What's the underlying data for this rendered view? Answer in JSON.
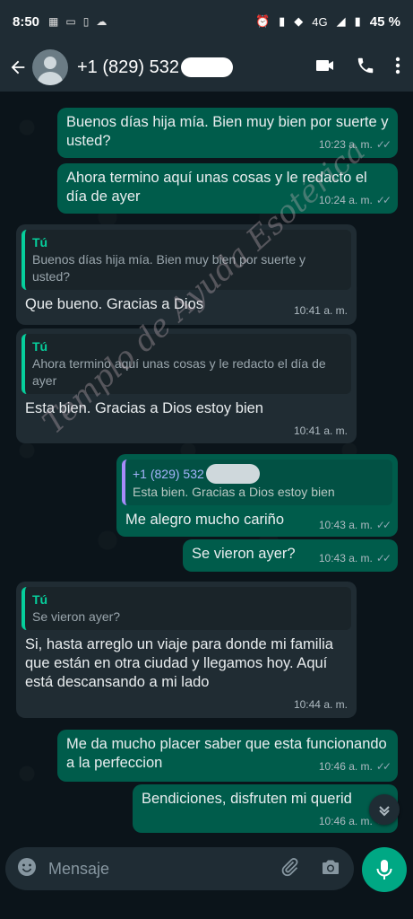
{
  "status_bar": {
    "time": "8:50",
    "network": "4G",
    "battery": "45 %"
  },
  "header": {
    "contact_name": "+1 (829) 532"
  },
  "messages": [
    {
      "dir": "out",
      "text": "Buenos días hija mía. Bien muy bien por suerte y usted?",
      "time": "10:23 a. m."
    },
    {
      "dir": "out",
      "text": "Ahora termino aquí unas cosas y le redacto el día de ayer",
      "time": "10:24 a. m."
    },
    {
      "dir": "in",
      "quote_author": "Tú",
      "quote_text": "Buenos días hija mía. Bien muy bien por suerte y usted?",
      "text": "Que bueno. Gracias a Dios",
      "time": "10:41 a. m."
    },
    {
      "dir": "in",
      "quote_author": "Tú",
      "quote_text": "Ahora termino aquí unas cosas y le redacto el día de ayer",
      "text": "Esta bien. Gracias a Dios estoy bien",
      "time": "10:41 a. m."
    },
    {
      "dir": "out",
      "quote_author": "+1 (829) 532",
      "quote_text": "Esta bien. Gracias a Dios estoy bien",
      "text": "Me alegro mucho cariño",
      "time": "10:43 a. m."
    },
    {
      "dir": "out",
      "text": "Se vieron ayer?",
      "time": "10:43 a. m."
    },
    {
      "dir": "in",
      "quote_author": "Tú",
      "quote_text": "Se vieron ayer?",
      "text": "Si, hasta arreglo un viaje para donde mi familia que están en otra ciudad y llegamos hoy. Aquí está descansando  a mi lado",
      "time": "10:44 a. m."
    },
    {
      "dir": "out",
      "text": "Me da mucho placer saber que esta funcionando a la perfeccion",
      "time": "10:46 a. m."
    },
    {
      "dir": "out",
      "text": "Bendiciones, disfruten mi querid",
      "time": "10:46 a. m."
    }
  ],
  "composer": {
    "placeholder": "Mensaje"
  },
  "watermark": "Templo de Ayuda Esotérica",
  "colors": {
    "outgoing_bubble": "#005c4b",
    "incoming_bubble": "#202c33",
    "accent": "#00a884",
    "quote_author": "#06cf9c"
  },
  "icons": [
    "back-arrow-icon",
    "video-call-icon",
    "phone-icon",
    "more-vert-icon",
    "emoji-icon",
    "attach-icon",
    "camera-icon",
    "mic-icon",
    "chevron-down-icon"
  ]
}
